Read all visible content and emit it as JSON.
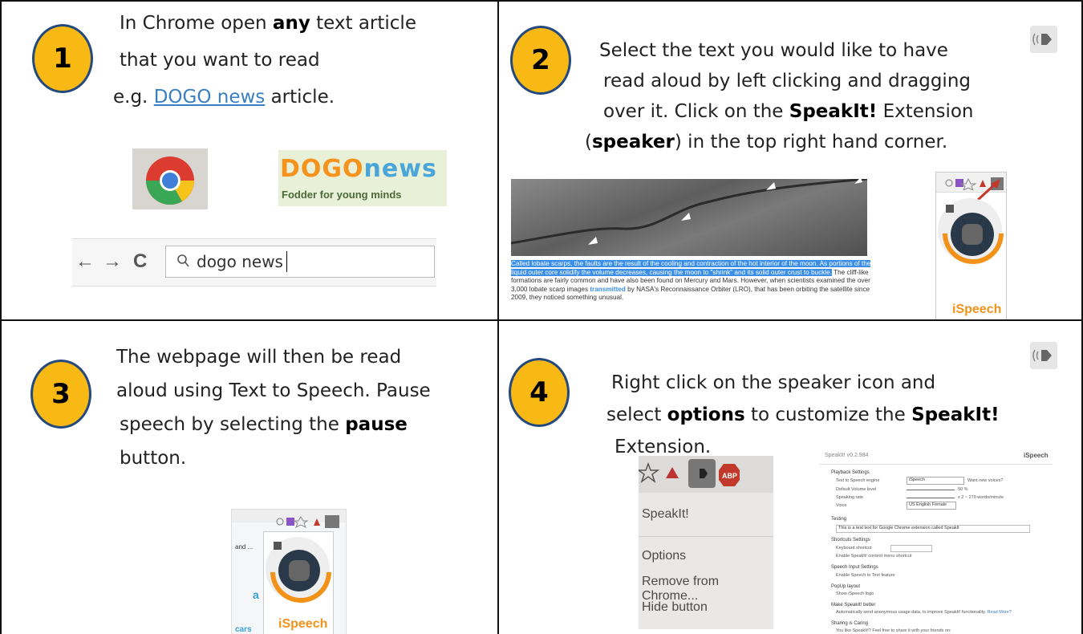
{
  "steps": [
    {
      "number": "1",
      "lines": {
        "l1_a": "In Chrome open ",
        "l1_b": "any",
        "l1_c": " text article",
        "l2": "that you want to read",
        "l3_a": "e.g. ",
        "l3_link": "DOGO news",
        "l3_c": " article."
      },
      "dogo_logo": {
        "part1": "DOGO",
        "part2": "news",
        "tagline": "Fodder for young minds"
      },
      "address_bar": {
        "back": "←",
        "forward": "→",
        "reload": "C",
        "value": "dogo news"
      }
    },
    {
      "number": "2",
      "lines": {
        "l1": "Select the text you would like to have",
        "l2": "read aloud by left clicking and dragging",
        "l3_a": "over it. Click on the ",
        "l3_b": "SpeakIt!",
        "l3_c": " Extension",
        "l4_a": "(",
        "l4_b": "speaker",
        "l4_c": ") in the top right hand corner."
      },
      "article": {
        "selected": "Called lobate scarps, the faults are the result of the cooling and contraction of the hot interior of the moon. As portions of the liquid outer core solidify the volume decreases, causing the moon to \"shrink\" and its solid outer crust to buckle.",
        "rest_a": " The cliff-like formations are fairly common and have also been found on Mercury and Mars. However, when scientists examined the over 3,000 lobate scarp images ",
        "rest_link": "transmitted",
        "rest_b": " by NASA's Reconnaissance Orbiter (LRO), that has been orbiting the satellite since 2009, they noticed something unusual."
      },
      "ispeech_logo": "iSpeech"
    },
    {
      "number": "3",
      "lines": {
        "l1": "The webpage will then be read",
        "l2": "aloud using Text to Speech. Pause",
        "l3_a": "speech by selecting the ",
        "l3_b": "pause",
        "l4": "button."
      },
      "page_snippet": {
        "tab_text": "and ...",
        "letter": "a",
        "cars": "cars"
      },
      "ispeech_logo": "iSpeech"
    },
    {
      "number": "4",
      "lines": {
        "l1": "Right click on the speaker icon and",
        "l2_a": "select ",
        "l2_b": "options",
        "l2_c": " to customize the ",
        "l2_d": "SpeakIt!",
        "l3": "Extension."
      },
      "context_menu": [
        "SpeakIt!",
        "Options",
        "Remove from Chrome...",
        "Hide button"
      ],
      "abp_badge": "ABP",
      "settings": {
        "title": "SpeakIt! v0.2.984",
        "logo": "iSpeech",
        "playback": "Playback Settings",
        "engine_label": "Text to Speech engine",
        "engine_value": "iSpeech",
        "new_voices": "Want new voices?",
        "volume_label": "Default Volume level",
        "volume_value": "50 %",
        "rate_label": "Speaking rate",
        "rate_value": "x 2 ~ 270 words/minute",
        "voice_label": "Voice",
        "voice_value": "US English Female",
        "testing": "Testing",
        "test_text": "This is a test text for Google Chrome extension called SpeakIt",
        "shortcuts": "Shortcuts Settings",
        "keyboard": "Keyboard shortcut",
        "context_menu_opt": "Enable SpeakIt! context menu shortcut",
        "speech_input": "Speech Input Settings",
        "speech_to_text": "Enable Speech to Text feature",
        "popup_layout": "PopUp layout",
        "show_logo": "Show iSpeech logo",
        "make_better": "Make SpeakIt! better",
        "anon": "Automatically send anonymous usage data, to improve SpeakIt! functionality.",
        "read_more": "Read More?",
        "sharing": "Sharing is Caring",
        "share_text": "You like SpeakIt!? Feel free to share it with your friends on:"
      }
    }
  ],
  "colors": {
    "badge_fill": "#f9b914",
    "badge_border": "#24497d",
    "link": "#3a7fc3",
    "selection": "#3b8ee8",
    "ispeech_orange": "#f39219"
  },
  "icons": [
    "speaker-icon",
    "chrome-logo-icon",
    "search-icon",
    "back-arrow-icon",
    "forward-arrow-icon",
    "reload-icon",
    "star-icon"
  ]
}
